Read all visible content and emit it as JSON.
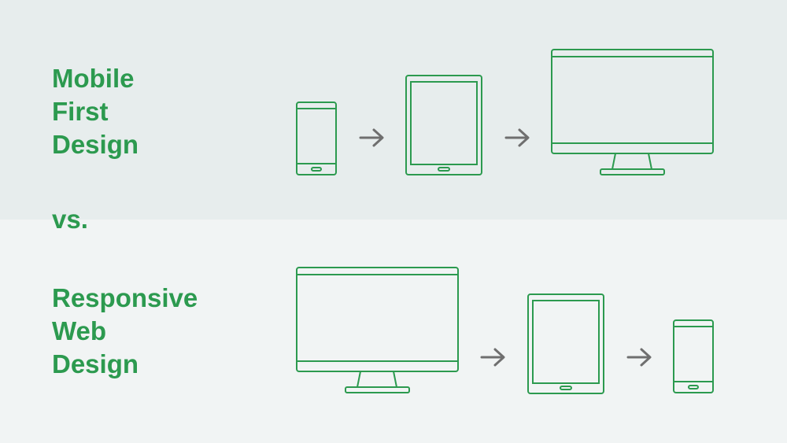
{
  "colors": {
    "accent": "#2c9a4f",
    "arrow": "#6f6f6f",
    "top_background": "#e7eded",
    "bottom_background": "#f1f4f4"
  },
  "mobile_first": {
    "title_lines": [
      "Mobile",
      "First",
      "Design"
    ],
    "sequence": [
      "phone-icon",
      "arrow-right-icon",
      "tablet-icon",
      "arrow-right-icon",
      "desktop-monitor-icon"
    ]
  },
  "separator": {
    "label": "vs."
  },
  "responsive": {
    "title_lines": [
      "Responsive",
      "Web",
      "Design"
    ],
    "sequence": [
      "desktop-monitor-icon",
      "arrow-right-icon",
      "tablet-icon",
      "arrow-right-icon",
      "phone-icon"
    ]
  }
}
